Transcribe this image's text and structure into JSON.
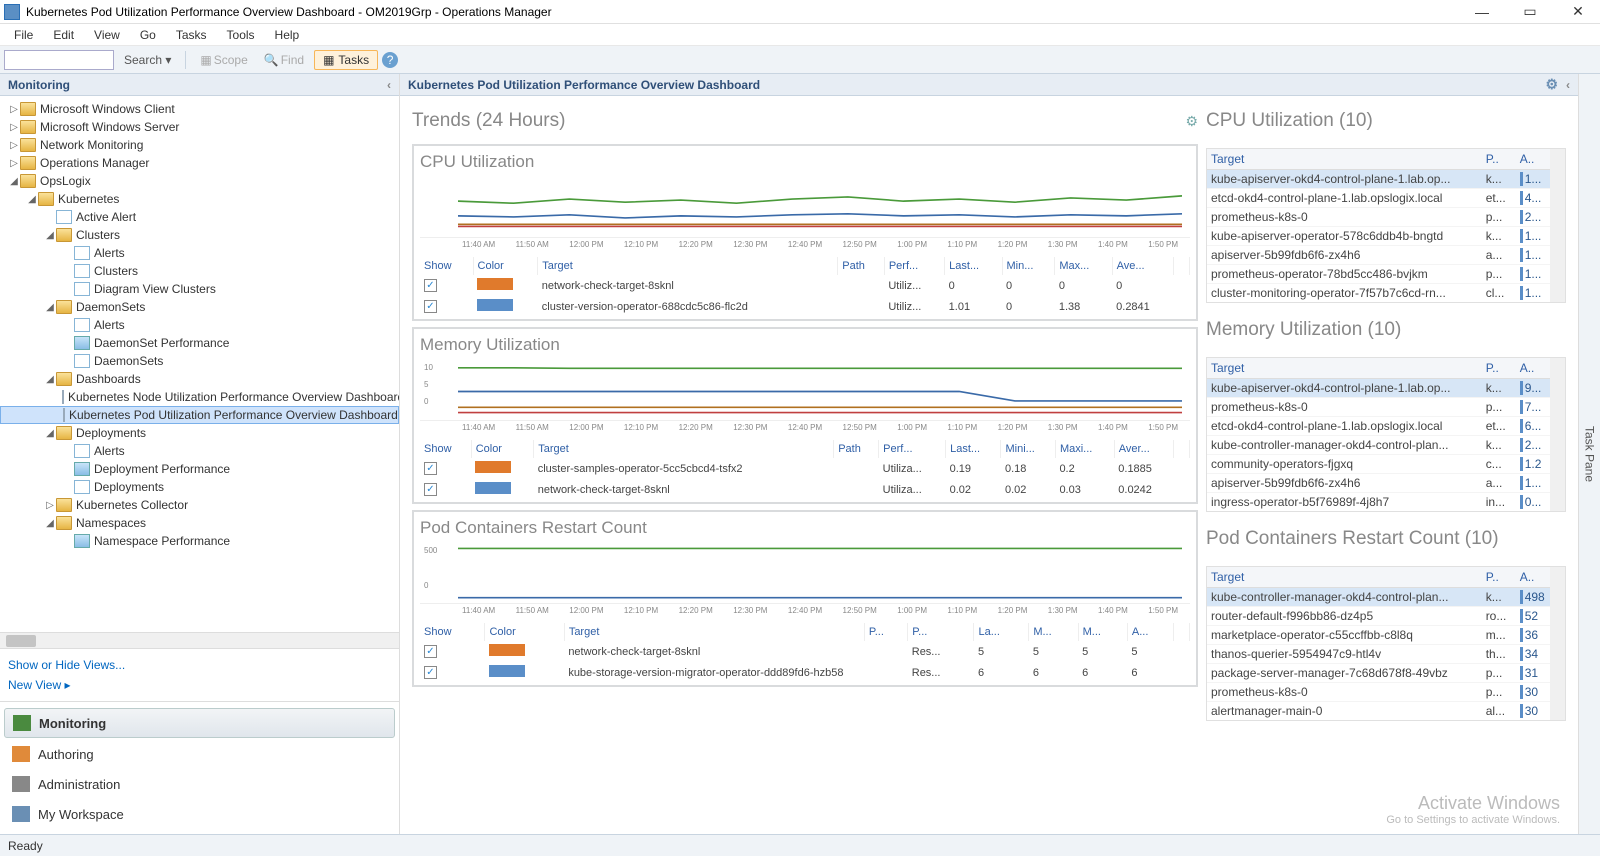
{
  "window": {
    "title": "Kubernetes Pod Utilization Performance Overview Dashboard - OM2019Grp - Operations Manager"
  },
  "menu": [
    "File",
    "Edit",
    "View",
    "Go",
    "Tasks",
    "Tools",
    "Help"
  ],
  "toolbar": {
    "search_placeholder": "",
    "search_btn": "Search ▾",
    "scope": "Scope",
    "find": "Find",
    "tasks": "Tasks"
  },
  "left": {
    "header": "Monitoring",
    "tree": [
      {
        "l": 0,
        "t": "▷",
        "i": "folder",
        "label": "Microsoft Windows Client"
      },
      {
        "l": 0,
        "t": "▷",
        "i": "folder",
        "label": "Microsoft Windows Server"
      },
      {
        "l": 0,
        "t": "▷",
        "i": "folder",
        "label": "Network Monitoring"
      },
      {
        "l": 0,
        "t": "▷",
        "i": "folder",
        "label": "Operations Manager"
      },
      {
        "l": 0,
        "t": "◢",
        "i": "folder",
        "label": "OpsLogix"
      },
      {
        "l": 1,
        "t": "◢",
        "i": "folder",
        "label": "Kubernetes"
      },
      {
        "l": 2,
        "t": " ",
        "i": "view",
        "label": "Active Alert"
      },
      {
        "l": 2,
        "t": "◢",
        "i": "folder",
        "label": "Clusters"
      },
      {
        "l": 3,
        "t": " ",
        "i": "view",
        "label": "Alerts"
      },
      {
        "l": 3,
        "t": " ",
        "i": "view",
        "label": "Clusters"
      },
      {
        "l": 3,
        "t": " ",
        "i": "view",
        "label": "Diagram View Clusters"
      },
      {
        "l": 2,
        "t": "◢",
        "i": "folder",
        "label": "DaemonSets"
      },
      {
        "l": 3,
        "t": " ",
        "i": "view",
        "label": "Alerts"
      },
      {
        "l": 3,
        "t": " ",
        "i": "chart",
        "label": "DaemonSet Performance"
      },
      {
        "l": 3,
        "t": " ",
        "i": "view",
        "label": "DaemonSets"
      },
      {
        "l": 2,
        "t": "◢",
        "i": "folder",
        "label": "Dashboards"
      },
      {
        "l": 3,
        "t": " ",
        "i": "dash",
        "label": "Kubernetes Node Utilization Performance Overview Dashboard"
      },
      {
        "l": 3,
        "t": " ",
        "i": "dash",
        "label": "Kubernetes Pod Utilization Performance Overview Dashboard",
        "sel": true
      },
      {
        "l": 2,
        "t": "◢",
        "i": "folder",
        "label": "Deployments"
      },
      {
        "l": 3,
        "t": " ",
        "i": "view",
        "label": "Alerts"
      },
      {
        "l": 3,
        "t": " ",
        "i": "chart",
        "label": "Deployment Performance"
      },
      {
        "l": 3,
        "t": " ",
        "i": "view",
        "label": "Deployments"
      },
      {
        "l": 2,
        "t": "▷",
        "i": "folder",
        "label": "Kubernetes Collector"
      },
      {
        "l": 2,
        "t": "◢",
        "i": "folder",
        "label": "Namespaces"
      },
      {
        "l": 3,
        "t": " ",
        "i": "chart",
        "label": "Namespace Performance"
      }
    ],
    "links": {
      "show_hide": "Show or Hide Views...",
      "new_view": "New View ▸"
    },
    "nav": [
      {
        "label": "Monitoring",
        "active": true,
        "cls": "ni-mon"
      },
      {
        "label": "Authoring",
        "cls": "ni-auth"
      },
      {
        "label": "Administration",
        "cls": "ni-adm"
      },
      {
        "label": "My Workspace",
        "cls": "ni-ws"
      }
    ]
  },
  "dashboard": {
    "title": "Kubernetes Pod Utilization Performance Overview Dashboard",
    "trends_label": "Trends (24 Hours)",
    "xaxis": [
      "11:40 AM",
      "11:50 AM",
      "12:00 PM",
      "12:10 PM",
      "12:20 PM",
      "12:30 PM",
      "12:40 PM",
      "12:50 PM",
      "1:00 PM",
      "1:10 PM",
      "1:20 PM",
      "1:30 PM",
      "1:40 PM",
      "1:50 PM"
    ],
    "legend_cols7": [
      "Show",
      "Color",
      "Target",
      "Path",
      "Perf...",
      "Last...",
      "Min...",
      "Max...",
      "Ave..."
    ],
    "legend_cols8": [
      "Show",
      "Color",
      "Target",
      "Path",
      "Perf...",
      "Last...",
      "Mini...",
      "Maxi...",
      "Aver..."
    ],
    "legend_cols9": [
      "Show",
      "Color",
      "Target",
      "P...",
      "P...",
      "La...",
      "M...",
      "M...",
      "A..."
    ],
    "charts": {
      "cpu": {
        "title": "CPU Utilization",
        "rows": [
          {
            "color": "#e07a2c",
            "target": "network-check-target-8sknl",
            "path": "",
            "perf": "Utiliz...",
            "last": "0",
            "min": "0",
            "max": "0",
            "avg": "0"
          },
          {
            "color": "#5a8ec8",
            "target": "cluster-version-operator-688cdc5c86-flc2d",
            "path": "",
            "perf": "Utiliz...",
            "last": "1.01",
            "min": "0",
            "max": "1.38",
            "avg": "0.2841"
          }
        ]
      },
      "mem": {
        "title": "Memory Utilization",
        "ylabels": [
          "10",
          "5",
          "0"
        ],
        "rows": [
          {
            "color": "#e07a2c",
            "target": "cluster-samples-operator-5cc5cbcd4-tsfx2",
            "path": "",
            "perf": "Utiliza...",
            "last": "0.19",
            "min": "0.18",
            "max": "0.2",
            "avg": "0.1885"
          },
          {
            "color": "#5a8ec8",
            "target": "network-check-target-8sknl",
            "path": "",
            "perf": "Utiliza...",
            "last": "0.02",
            "min": "0.02",
            "max": "0.03",
            "avg": "0.0242"
          }
        ]
      },
      "restart": {
        "title": "Pod Containers Restart Count",
        "ylabels": [
          "500",
          "0"
        ],
        "rows": [
          {
            "color": "#e07a2c",
            "target": "network-check-target-8sknl",
            "path": "",
            "perf": "Res...",
            "last": "5",
            "min": "5",
            "max": "5",
            "avg": "5"
          },
          {
            "color": "#5a8ec8",
            "target": "kube-storage-version-migrator-operator-ddd89fd6-hzb58",
            "path": "",
            "perf": "Res...",
            "last": "6",
            "min": "6",
            "max": "6",
            "avg": "6"
          }
        ]
      }
    }
  },
  "rightcol": {
    "cpu": {
      "title": "CPU Utilization (10)",
      "cols": [
        "Target",
        "P..",
        "A.."
      ],
      "rows": [
        {
          "t": "kube-apiserver-okd4-control-plane-1.lab.op...",
          "p": "k...",
          "a": "1...",
          "hl": true
        },
        {
          "t": "etcd-okd4-control-plane-1.lab.opslogix.local",
          "p": "et...",
          "a": "4..."
        },
        {
          "t": "prometheus-k8s-0",
          "p": "p...",
          "a": "2..."
        },
        {
          "t": "kube-apiserver-operator-578c6ddb4b-bngtd",
          "p": "k...",
          "a": "1..."
        },
        {
          "t": "apiserver-5b99fdb6f6-zx4h6",
          "p": "a...",
          "a": "1..."
        },
        {
          "t": "prometheus-operator-78bd5cc486-bvjkm",
          "p": "p...",
          "a": "1..."
        },
        {
          "t": "cluster-monitoring-operator-7f57b7c6cd-rn...",
          "p": "cl...",
          "a": "1..."
        }
      ]
    },
    "mem": {
      "title": "Memory Utilization (10)",
      "cols": [
        "Target",
        "P..",
        "A.."
      ],
      "rows": [
        {
          "t": "kube-apiserver-okd4-control-plane-1.lab.op...",
          "p": "k...",
          "a": "9...",
          "hl": true
        },
        {
          "t": "prometheus-k8s-0",
          "p": "p...",
          "a": "7..."
        },
        {
          "t": "etcd-okd4-control-plane-1.lab.opslogix.local",
          "p": "et...",
          "a": "6..."
        },
        {
          "t": "kube-controller-manager-okd4-control-plan...",
          "p": "k...",
          "a": "2..."
        },
        {
          "t": "community-operators-fjgxq",
          "p": "c...",
          "a": "1.2"
        },
        {
          "t": "apiserver-5b99fdb6f6-zx4h6",
          "p": "a...",
          "a": "1..."
        },
        {
          "t": "ingress-operator-b5f76989f-4j8h7",
          "p": "in...",
          "a": "0..."
        }
      ]
    },
    "restart": {
      "title": "Pod Containers Restart Count (10)",
      "cols": [
        "Target",
        "P..",
        "A.."
      ],
      "rows": [
        {
          "t": "kube-controller-manager-okd4-control-plan...",
          "p": "k...",
          "a": "498",
          "hl": true
        },
        {
          "t": "router-default-f996bb86-dz4p5",
          "p": "ro...",
          "a": "52"
        },
        {
          "t": "marketplace-operator-c55ccffbb-c8l8q",
          "p": "m...",
          "a": "36"
        },
        {
          "t": "thanos-querier-5954947c9-htl4v",
          "p": "th...",
          "a": "34"
        },
        {
          "t": "package-server-manager-7c68d678f8-49vbz",
          "p": "p...",
          "a": "31"
        },
        {
          "t": "prometheus-k8s-0",
          "p": "p...",
          "a": "30"
        },
        {
          "t": "alertmanager-main-0",
          "p": "al...",
          "a": "30"
        }
      ]
    }
  },
  "watermark": {
    "line1": "Activate Windows",
    "line2": "Go to Settings to activate Windows."
  },
  "task_pane": "Task Pane",
  "status": "Ready",
  "chart_data": [
    {
      "type": "line",
      "title": "CPU Utilization",
      "x": [
        "11:40",
        "11:50",
        "12:00",
        "12:10",
        "12:20",
        "12:30",
        "12:40",
        "12:50",
        "13:00",
        "13:10",
        "13:20",
        "13:30",
        "13:40",
        "13:50"
      ],
      "series": [
        {
          "name": "green",
          "values": [
            3.2,
            3.0,
            3.4,
            3.1,
            3.3,
            3.0,
            3.4,
            3.6,
            3.2,
            3.4,
            3.1,
            3.5,
            3.3,
            3.7
          ]
        },
        {
          "name": "blue",
          "values": [
            1.8,
            1.7,
            1.9,
            1.6,
            1.8,
            1.7,
            1.9,
            2.0,
            1.8,
            1.9,
            1.7,
            1.9,
            1.8,
            2.0
          ]
        },
        {
          "name": "brown",
          "values": [
            1.0,
            1.0,
            1.0,
            1.0,
            1.0,
            1.0,
            1.0,
            1.0,
            1.0,
            1.0,
            1.0,
            1.0,
            1.0,
            1.0
          ]
        },
        {
          "name": "red",
          "values": [
            0.8,
            0.8,
            0.8,
            0.8,
            0.8,
            0.8,
            0.8,
            0.8,
            0.8,
            0.8,
            0.8,
            0.8,
            0.8,
            0.8
          ]
        }
      ]
    },
    {
      "type": "line",
      "title": "Memory Utilization",
      "ylim": [
        0,
        10
      ],
      "x": [
        "11:40",
        "11:50",
        "12:00",
        "12:10",
        "12:20",
        "12:30",
        "12:40",
        "12:50",
        "13:00",
        "13:10",
        "13:20",
        "13:30",
        "13:40",
        "13:50"
      ],
      "series": [
        {
          "name": "top",
          "values": [
            9.5,
            9.5,
            9.4,
            9.4,
            9.4,
            9.4,
            9.4,
            9.4,
            9.4,
            9.4,
            9.4,
            9.4,
            9.4,
            9.4
          ]
        },
        {
          "name": "orange",
          "values": [
            5.0,
            5.0,
            5.0,
            5.0,
            5.0,
            5.0,
            5.0,
            5.0,
            5.0,
            5.0,
            3.2,
            3.2,
            3.2,
            3.2
          ]
        },
        {
          "name": "pink",
          "values": [
            2.0,
            2.0,
            2.0,
            2.0,
            2.0,
            2.0,
            2.0,
            2.0,
            2.0,
            2.0,
            2.0,
            2.0,
            2.0,
            2.0
          ]
        },
        {
          "name": "purple",
          "values": [
            1.0,
            1.0,
            1.0,
            1.0,
            1.0,
            1.0,
            1.0,
            1.0,
            1.0,
            1.0,
            1.0,
            1.0,
            1.0,
            1.0
          ]
        }
      ]
    },
    {
      "type": "line",
      "title": "Pod Containers Restart Count",
      "ylim": [
        0,
        500
      ],
      "x": [
        "11:40",
        "11:50",
        "12:00",
        "12:10",
        "12:20",
        "12:30",
        "12:40",
        "12:50",
        "13:00",
        "13:10",
        "13:20",
        "13:30",
        "13:40",
        "13:50"
      ],
      "series": [
        {
          "name": "blue",
          "values": [
            498,
            498,
            498,
            498,
            498,
            498,
            498,
            498,
            498,
            498,
            498,
            498,
            498,
            498
          ]
        },
        {
          "name": "others",
          "values": [
            30,
            30,
            30,
            30,
            30,
            30,
            30,
            30,
            30,
            30,
            30,
            30,
            30,
            30
          ]
        }
      ]
    }
  ]
}
